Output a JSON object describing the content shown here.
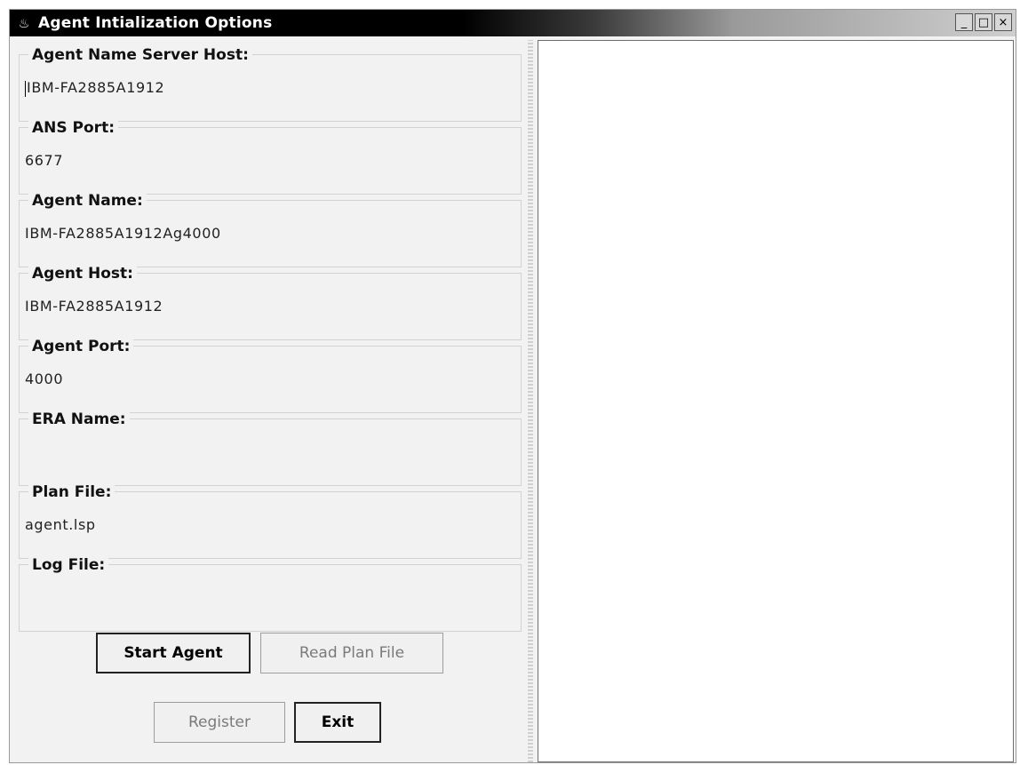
{
  "window": {
    "title": "Agent Intialization Options",
    "icon": "java-cup-icon",
    "controls": {
      "minimize": "_",
      "maximize": "□",
      "close": "×"
    }
  },
  "fields": [
    {
      "label": "Agent Name Server Host:",
      "value": "IBM-FA2885A1912",
      "focused": true
    },
    {
      "label": "ANS Port:",
      "value": "6677"
    },
    {
      "label": "Agent Name:",
      "value": "IBM-FA2885A1912Ag4000"
    },
    {
      "label": "Agent Host:",
      "value": "IBM-FA2885A1912"
    },
    {
      "label": "Agent Port:",
      "value": "4000"
    },
    {
      "label": "ERA Name:",
      "value": ""
    },
    {
      "label": "Plan File:",
      "value": "agent.lsp"
    },
    {
      "label": "Log File:",
      "value": ""
    }
  ],
  "buttons": {
    "start_agent": "Start Agent",
    "read_plan_file": "Read Plan File",
    "register": "Register",
    "exit": "Exit"
  }
}
